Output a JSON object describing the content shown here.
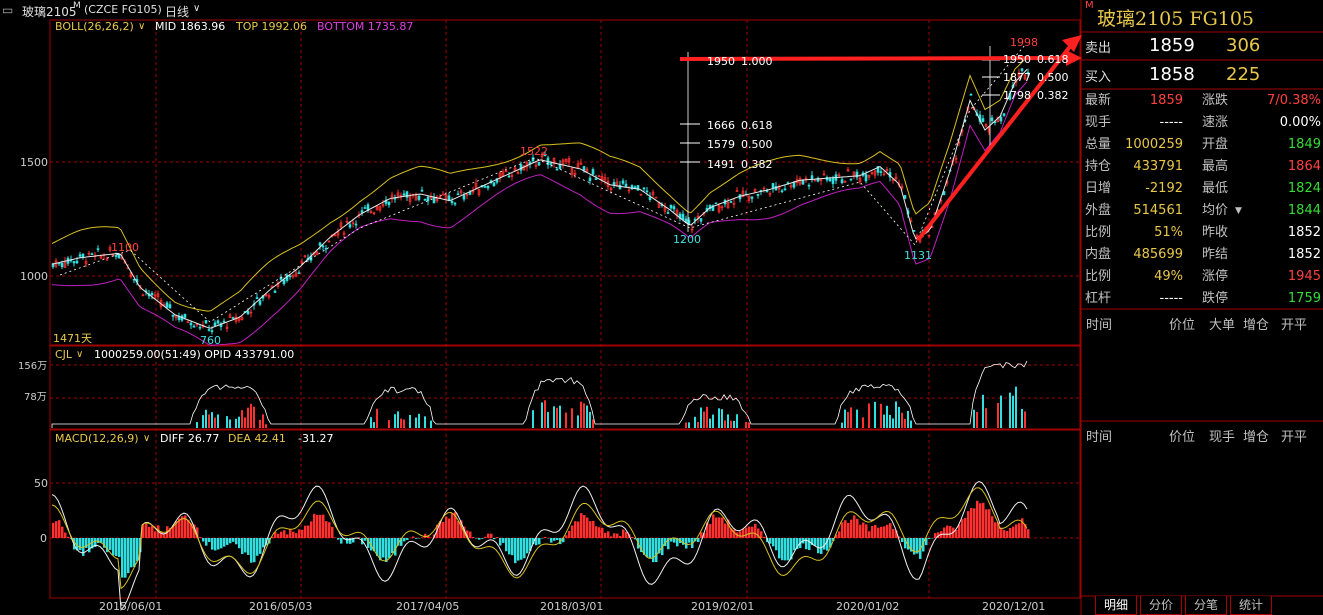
{
  "window": {
    "symbol_title": "玻璃2105",
    "mark": "M",
    "code": "(CZCE FG105)",
    "period": "日线",
    "period_arrow": "∨"
  },
  "boll": {
    "label": "BOLL(26,26,2)",
    "mid": "MID 1863.96",
    "top": "TOP 1992.06",
    "bottom": "BOTTOM 1735.87"
  },
  "price_axis": [
    "1500",
    "1000"
  ],
  "annotations": {
    "high_label": "1998",
    "peak_2018": "1522",
    "low_2019": "1200",
    "low_2020": "1131",
    "low_2016": "760",
    "high_2015": "1100",
    "days": "1471天"
  },
  "fib_levels": [
    {
      "price": "1950",
      "ratio": "1.000"
    },
    {
      "price": "1666",
      "ratio": "0.618"
    },
    {
      "price": "1579",
      "ratio": "0.500"
    },
    {
      "price": "1491",
      "ratio": "0.382"
    }
  ],
  "fib_levels_right": [
    {
      "price": "1950",
      "ratio": "0.618"
    },
    {
      "price": "1877",
      "ratio": "0.500"
    },
    {
      "price": "1798",
      "ratio": "0.382"
    }
  ],
  "volume": {
    "label": "CJL",
    "text": "1000259.00(51:49)  OPID 433791.00",
    "axis": [
      "156万",
      "78万"
    ]
  },
  "macd": {
    "label": "MACD(12,26,9)",
    "diff": "DIFF 26.77",
    "dea": "DEA 42.41",
    "macd": "-31.27",
    "axis": [
      "50",
      "0"
    ]
  },
  "date_axis": [
    "2015/06/01",
    "2016/05/03",
    "2017/04/05",
    "2018/03/01",
    "2019/02/01",
    "2020/01/02",
    "2020/12/01"
  ],
  "quote": {
    "title": "玻璃2105  FG105",
    "mark": "M",
    "sell": {
      "label": "卖出",
      "price": "1859",
      "vol": "306"
    },
    "buy": {
      "label": "买入",
      "price": "1858",
      "vol": "225"
    },
    "rows": [
      {
        "l1": "最新",
        "v1": "1859",
        "c1": "red",
        "l2": "涨跌",
        "v2": "7/0.38%",
        "c2": "red"
      },
      {
        "l1": "现手",
        "v1": "-----",
        "c1": "white",
        "l2": "速涨",
        "v2": "0.00%",
        "c2": "white"
      },
      {
        "l1": "总量",
        "v1": "1000259",
        "c1": "gold",
        "l2": "开盘",
        "v2": "1849",
        "c2": "green"
      },
      {
        "l1": "持仓",
        "v1": "433791",
        "c1": "gold",
        "l2": "最高",
        "v2": "1864",
        "c2": "red"
      },
      {
        "l1": "日增",
        "v1": "-2192",
        "c1": "gold",
        "l2": "最低",
        "v2": "1824",
        "c2": "green"
      },
      {
        "l1": "外盘",
        "v1": "514561",
        "c1": "gold",
        "l2": "均价",
        "v2": "1844",
        "c2": "green"
      },
      {
        "l1": "比例",
        "v1": "51%",
        "c1": "gold",
        "l2": "昨收",
        "v2": "1852",
        "c2": "white"
      },
      {
        "l1": "内盘",
        "v1": "485699",
        "c1": "gold",
        "l2": "昨结",
        "v2": "1852",
        "c2": "white"
      },
      {
        "l1": "比例",
        "v1": "49%",
        "c1": "gold",
        "l2": "涨停",
        "v2": "1945",
        "c2": "red"
      },
      {
        "l1": "杠杆",
        "v1": "-----",
        "c1": "white",
        "l2": "跌停",
        "v2": "1759",
        "c2": "green"
      }
    ],
    "ticks_header": [
      "时间",
      "价位",
      "大单",
      "增仓",
      "开平"
    ],
    "trades_header": [
      "时间",
      "价位",
      "现手",
      "增仓",
      "开平"
    ]
  },
  "tabs": [
    "明细",
    "分价",
    "分笔",
    "统计"
  ],
  "colors": {
    "grid_red": "#a00000",
    "up": "#ff3030",
    "down": "#30e0e0",
    "boll_mid": "#e8e8e8",
    "boll_top": "#d8c020",
    "boll_bottom": "#c020c0",
    "trend_arrow": "#ff2020"
  }
}
